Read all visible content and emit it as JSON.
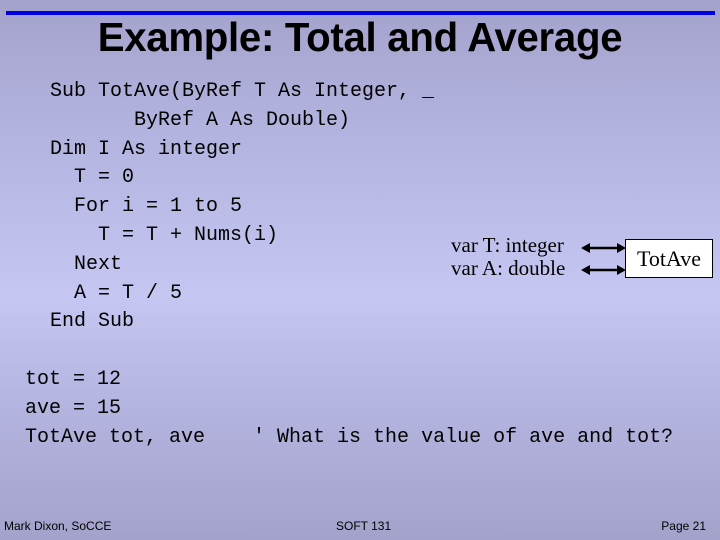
{
  "slide": {
    "title": "Example: Total and Average",
    "accent_line_color": "#0000e0",
    "procedure_code": [
      "Sub TotAve(ByRef T As Integer, _",
      "       ByRef A As Double)",
      "Dim I As integer",
      "  T = 0",
      "  For i = 1 to 5",
      "    T = T + Nums(i)",
      "  Next",
      "  A = T / 5",
      "End Sub"
    ],
    "call_code": [
      "tot = 12",
      "ave = 15",
      "TotAve tot, ave    ' What is the value of ave and tot?"
    ],
    "diagram": {
      "variables": [
        "var T: integer",
        "var A: double"
      ],
      "procedure_label": "TotAve",
      "arrow_type": "bidirectional"
    }
  },
  "footer": {
    "author": "Mark Dixon, SoCCE",
    "course": "SOFT 131",
    "page": "Page 21"
  }
}
